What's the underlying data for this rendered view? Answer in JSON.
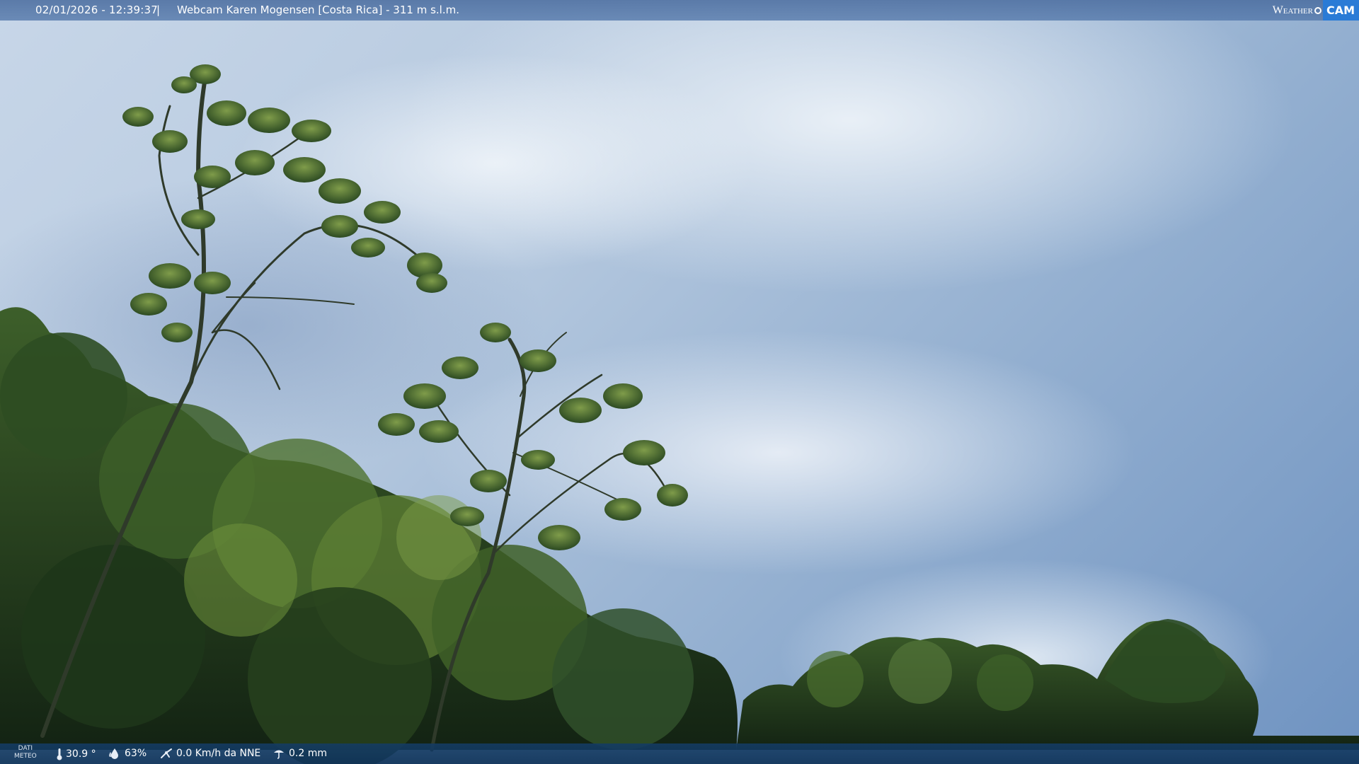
{
  "overlay_top": {
    "datetime": "02/01/2026 - 12:39:37",
    "separator": "|",
    "title": "Webcam Karen Mogensen [Costa Rica] - 311 m s.l.m.",
    "logo_word": "Weather",
    "logo_cam": "CAM"
  },
  "overlay_bottom": {
    "dati_line1": "DATI",
    "dati_line2": "METEO",
    "temperature": "30.9 °",
    "humidity": "63%",
    "wind": "0.0 Km/h da NNE",
    "rain": "0.2 mm"
  },
  "icons": {
    "temperature": "thermometer-icon",
    "humidity": "humidity-drop-icon",
    "wind": "wind-icon",
    "rain": "rain-gauge-icon"
  },
  "colors": {
    "top_bar": "#5477ab",
    "bottom_bar": "#123a66",
    "logo_cam_bg": "#2a7bd6",
    "sky_light": "#c7d6e8",
    "sky_deep": "#6f93c1",
    "foliage_dark": "#1f3a1c",
    "foliage_light": "#6e8f3a"
  }
}
